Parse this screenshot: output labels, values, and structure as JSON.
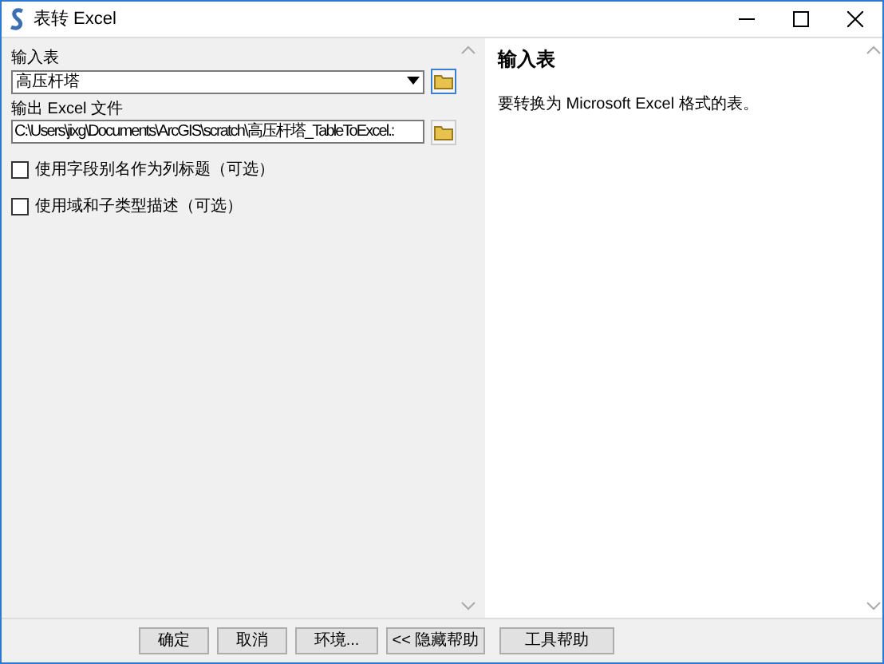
{
  "window": {
    "title": "表转 Excel"
  },
  "form": {
    "fields": [
      {
        "kind": "dropdown",
        "label": "输入表",
        "value": "高压杆塔"
      },
      {
        "kind": "file",
        "label": "输出 Excel 文件",
        "value": "C:\\Users\\jixg\\Documents\\ArcGIS\\scratch\\高压杆塔_TableToExcel.:"
      }
    ],
    "options": [
      {
        "label": "使用字段别名作为列标题（可选）",
        "checked": false
      },
      {
        "label": "使用域和子类型描述（可选）",
        "checked": false
      }
    ]
  },
  "help": {
    "title": "输入表",
    "text": "要转换为 Microsoft Excel 格式的表。"
  },
  "buttons": [
    "确定",
    "取消",
    "环境...",
    "<< 隐藏帮助",
    "工具帮助"
  ]
}
